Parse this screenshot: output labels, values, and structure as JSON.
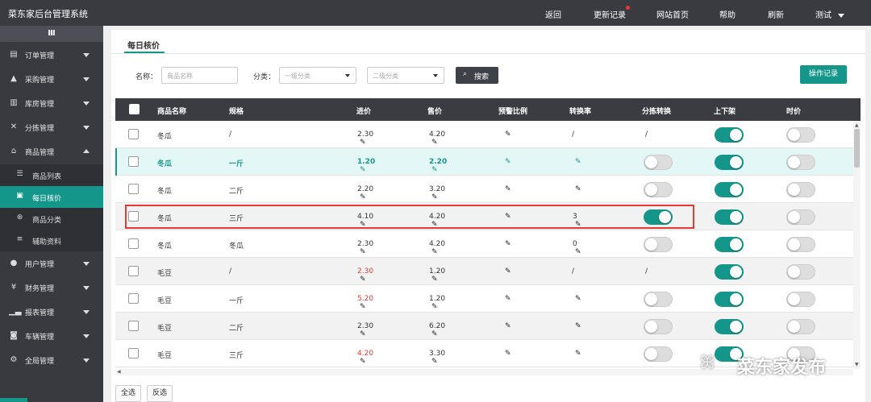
{
  "header": {
    "app_title": "菜东家后台管理系统",
    "nav": [
      "返回",
      "更新记录",
      "网站首页",
      "帮助",
      "刷新"
    ],
    "user": "测试"
  },
  "sidebar": {
    "collapse_icon": "Ⅲ",
    "groups_top": [
      {
        "label": "订单管理",
        "icon": "order-icon"
      },
      {
        "label": "采购管理",
        "icon": "shopping-bag-icon"
      },
      {
        "label": "库房管理",
        "icon": "warehouse-icon"
      },
      {
        "label": "分拣管理",
        "icon": "shuffle-icon"
      },
      {
        "label": "商品管理",
        "icon": "shop-icon"
      }
    ],
    "sub_items": [
      {
        "label": "商品列表",
        "icon": "list-icon"
      },
      {
        "label": "每日核价",
        "icon": "calendar-icon"
      },
      {
        "label": "商品分类",
        "icon": "category-icon"
      },
      {
        "label": "辅助资料",
        "icon": "menu-lines-icon"
      }
    ],
    "groups_bottom": [
      {
        "label": "用户管理",
        "icon": "users-icon"
      },
      {
        "label": "财务管理",
        "icon": "yen-icon"
      },
      {
        "label": "报表管理",
        "icon": "bar-chart-icon"
      },
      {
        "label": "车辆管理",
        "icon": "car-icon"
      },
      {
        "label": "全局管理",
        "icon": "gears-icon"
      }
    ]
  },
  "main": {
    "tab_label": "每日核价",
    "filters": {
      "name_label": "名称：",
      "name_placeholder": "商品名称",
      "category_label": "分类：",
      "category1": "一级分类",
      "category2": "二级分类",
      "search_label": "搜索",
      "log_button": "操作记录"
    },
    "columns": [
      "商品名称",
      "规格",
      "进价",
      "售价",
      "预警比例",
      "转换率",
      "分拣转换",
      "上下架",
      "时价"
    ],
    "rows": [
      {
        "name": "冬瓜",
        "spec": "/",
        "cost": "2.30",
        "price": "4.20",
        "rate": "/",
        "sort": "/",
        "sort_toggle": null,
        "shelf": true,
        "market": false,
        "style": "white"
      },
      {
        "name": "冬瓜",
        "spec": "一斤",
        "cost": "1.20",
        "price": "2.20",
        "rate": "",
        "sort": "",
        "sort_toggle": false,
        "shelf": true,
        "market": false,
        "style": "hl"
      },
      {
        "name": "冬瓜",
        "spec": "二斤",
        "cost": "2.20",
        "price": "3.20",
        "rate": "",
        "sort": "",
        "sort_toggle": false,
        "shelf": true,
        "market": false,
        "style": "white"
      },
      {
        "name": "冬瓜",
        "spec": "三斤",
        "cost": "4.10",
        "price": "4.20",
        "rate": "3",
        "sort": "",
        "sort_toggle": true,
        "shelf": true,
        "market": false,
        "style": "striped"
      },
      {
        "name": "冬瓜",
        "spec": "冬瓜",
        "cost": "2.30",
        "price": "4.20",
        "rate": "0",
        "sort": "",
        "sort_toggle": false,
        "shelf": true,
        "market": false,
        "style": "white"
      },
      {
        "name": "毛豆",
        "spec": "/",
        "cost": "2.30",
        "price": "1.20",
        "rate": "/",
        "sort": "/",
        "sort_toggle": null,
        "shelf": true,
        "market": false,
        "style": "striped",
        "cost_red": true
      },
      {
        "name": "毛豆",
        "spec": "一斤",
        "cost": "5.20",
        "price": "1.20",
        "rate": "",
        "sort": "",
        "sort_toggle": false,
        "shelf": true,
        "market": false,
        "style": "white",
        "cost_red": true
      },
      {
        "name": "毛豆",
        "spec": "二斤",
        "cost": "2.30",
        "price": "6.20",
        "rate": "",
        "sort": "",
        "sort_toggle": false,
        "shelf": true,
        "market": false,
        "style": "striped"
      },
      {
        "name": "毛豆",
        "spec": "三斤",
        "cost": "4.20",
        "price": "3.30",
        "rate": "",
        "sort": "",
        "sort_toggle": false,
        "shelf": true,
        "market": false,
        "style": "white",
        "cost_red": true
      }
    ],
    "select_all": "全选",
    "invert_select": "反选"
  },
  "watermark": {
    "text": "菜东家发布",
    "icon": "wechat-logo-icon"
  },
  "colors": {
    "accent": "#15968a",
    "header": "#3a3b41",
    "sidebar": "#393a40",
    "red": "#e53935"
  }
}
